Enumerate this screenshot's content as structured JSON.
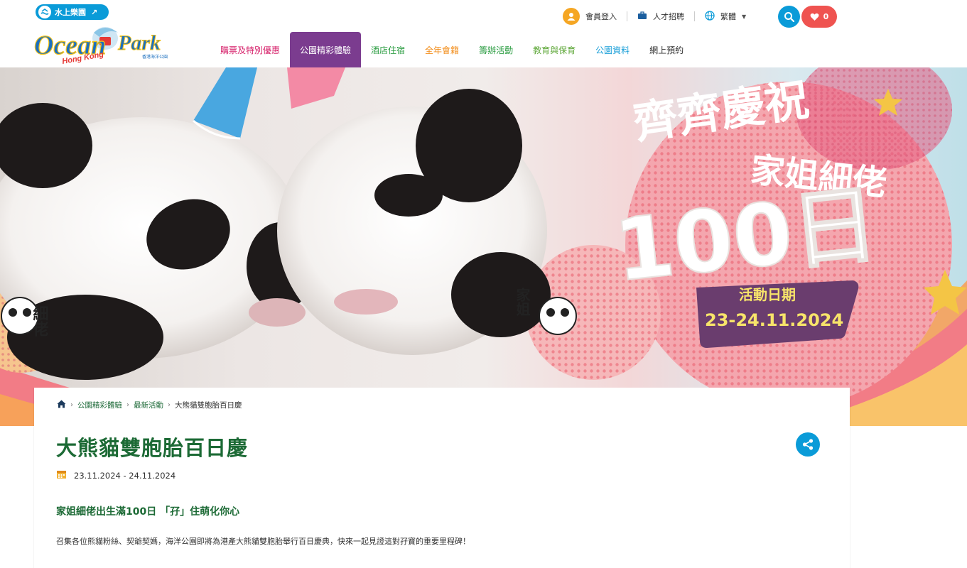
{
  "header": {
    "group_label": "水上樂園",
    "logo_text": "Ocean Park",
    "logo_sub": "Hong Kong",
    "logo_cn": "香港海洋公園",
    "member_login": "會員登入",
    "careers": "人才招聘",
    "language": "繁體",
    "favorites_count": "0",
    "nav": [
      {
        "label": "購票及特別優惠",
        "color": "#d61f69"
      },
      {
        "label": "公園精彩體驗",
        "color": "#ffffff"
      },
      {
        "label": "酒店住宿",
        "color": "#2e9e44"
      },
      {
        "label": "全年會籍",
        "color": "#f28c18"
      },
      {
        "label": "籌辦活動",
        "color": "#2e9e44"
      },
      {
        "label": "教育與保育",
        "color": "#5fa83a"
      },
      {
        "label": "公園資料",
        "color": "#1a9fd8"
      },
      {
        "label": "網上預約",
        "color": "#333333"
      }
    ],
    "active_nav_index": 1,
    "active_nav_color": "#7b3c8f"
  },
  "banner": {
    "headline_line1": "齊齊慶祝",
    "headline_line2": "家姐細佬",
    "headline_big": "100日",
    "period_label": "活動日期",
    "period_dates": "23-24.11.2024",
    "panda_left_name": "細佬",
    "panda_right_name": "家姐"
  },
  "breadcrumb": {
    "items": [
      "公園精彩體驗",
      "最新活動",
      "大熊貓雙胞胎百日慶"
    ]
  },
  "article": {
    "title": "大熊貓雙胞胎百日慶",
    "date_range": "23.11.2024 - 24.11.2024",
    "subtitle": "家姐細佬出生滿100日 「孖」住萌化你心",
    "intro": "召集各位熊貓粉絲、契爺契媽，海洋公園即將為港產大熊貓雙胞胎舉行百日慶典，快來一起見證這對孖寶的重要里程碑！"
  },
  "colors": {
    "brand_blue": "#0a9bd8",
    "brand_green": "#1c6a35",
    "purple": "#7b3c8f",
    "favorite_red": "#ef5350"
  }
}
